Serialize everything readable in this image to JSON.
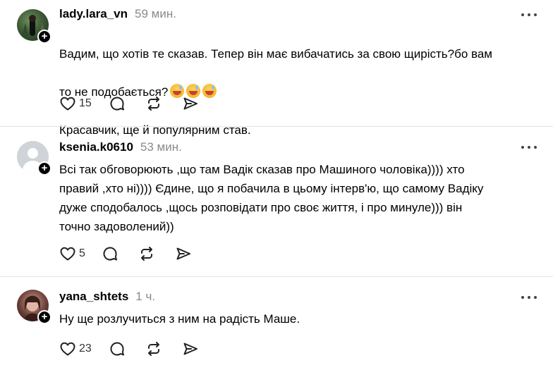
{
  "posts": [
    {
      "username": "lady.lara_vn",
      "time": "59 мин.",
      "text_lines": [
        "Вадим, що хотів те сказав. Тепер він має вибачатись за свою щирість?бо вам",
        "то не подобається?"
      ],
      "emoji_count": 3,
      "text_after": "Красавчик, ще й популярним став.",
      "likes": "15",
      "avatar": "photo-dark-green"
    },
    {
      "username": "ksenia.k0610",
      "time": "53 мин.",
      "text": "Всі так обговорюють ,що там Вадік сказав про Машиного чоловіка)))) хто\nправий ,хто ні)))) Єдине, що я побачила в цьому інтерв'ю, що самому Вадіку\nдуже сподобалось ,щось розповідати про своє життя, і про минуле))) він\nточно задоволений))",
      "likes": "5",
      "avatar": "default"
    },
    {
      "username": "yana_shtets",
      "time": "1 ч.",
      "text": "Ну ще розлучиться з ним на радість Маше.",
      "likes": "23",
      "avatar": "photo-portrait"
    }
  ],
  "icons": {
    "like": "heart-icon",
    "reply": "comment-icon",
    "repost": "repost-icon",
    "share": "send-icon",
    "more": "more-icon",
    "follow": "plus-icon",
    "emoji": "grinning-sweat-emoji"
  },
  "colors": {
    "text": "#000000",
    "muted": "#8a8a8a",
    "divider": "#e3e3e3"
  }
}
